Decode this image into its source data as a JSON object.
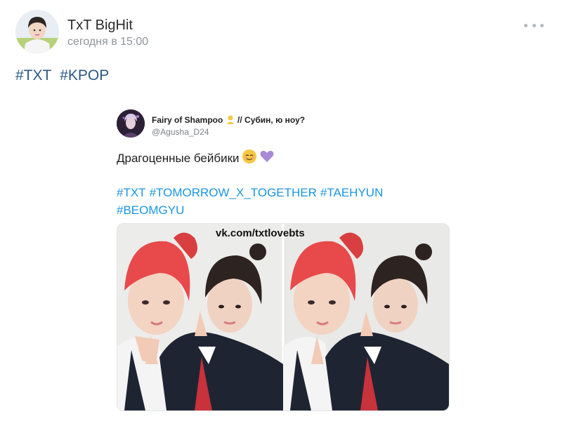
{
  "post": {
    "author": "TxT BigHit",
    "time": "сегодня в 15:00",
    "hashtags": [
      "#TXT",
      "#KPOP"
    ]
  },
  "tweet": {
    "display_name": "Fairy of Shampoo",
    "name_suffix": "// Субин, ю ноу?",
    "handle": "@Agusha_D24",
    "text": "Драгоценные бейбики",
    "tags": [
      "#TXT",
      "#TOMORROW_X_TOGETHER",
      "#TAEHYUN",
      "#BEOMGYU"
    ],
    "image_watermark": "vk.com/txtlovebts"
  },
  "icons": {
    "more": "more-dots-icon",
    "emoji_1": "smiling-face-emoji-icon",
    "emoji_2": "purple-heart-icon",
    "name_emoji": "person-emoji-icon"
  },
  "colors": {
    "vk_link": "#2a5885",
    "twitter_link": "#1b95e0",
    "hair_red": "#e8494a",
    "blazer_dark": "#1f2433"
  }
}
